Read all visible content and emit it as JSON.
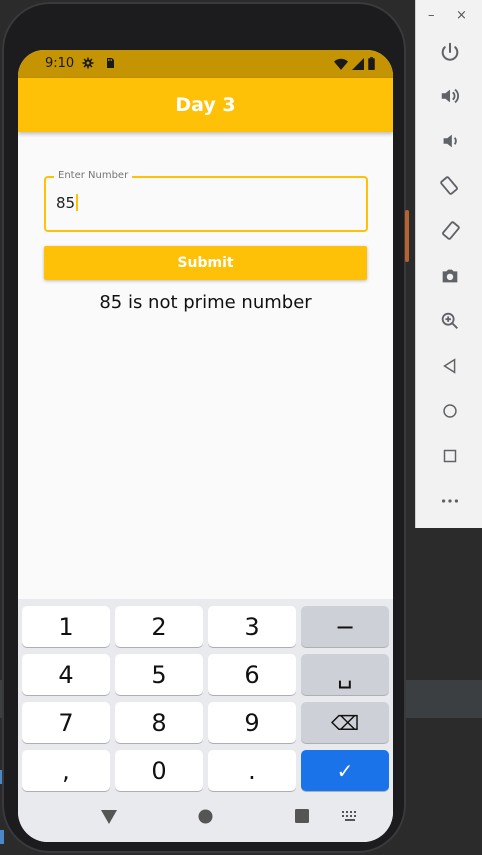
{
  "emulator": {
    "window_controls": {
      "minimize": "–",
      "close": "×"
    },
    "buttons": [
      "power-icon",
      "volume-up-icon",
      "volume-down-icon",
      "rotate-left-icon",
      "rotate-right-icon",
      "camera-icon",
      "zoom-icon",
      "back-icon",
      "home-icon",
      "overview-icon",
      "more-icon"
    ]
  },
  "status_bar": {
    "time": "9:10"
  },
  "app_bar": {
    "title": "Day 3"
  },
  "form": {
    "label": "Enter Number",
    "value": "85",
    "submit_label": "Submit",
    "result": "85 is not prime number"
  },
  "keyboard": {
    "keys": [
      "1",
      "2",
      "3",
      "−",
      "4",
      "5",
      "6",
      "␣",
      "7",
      "8",
      "9",
      "⌫",
      ",",
      "0",
      ".",
      "✓"
    ]
  },
  "colors": {
    "accent": "#ffc107",
    "status_bar": "#c49403",
    "keyboard_action": "#1a73e8"
  }
}
